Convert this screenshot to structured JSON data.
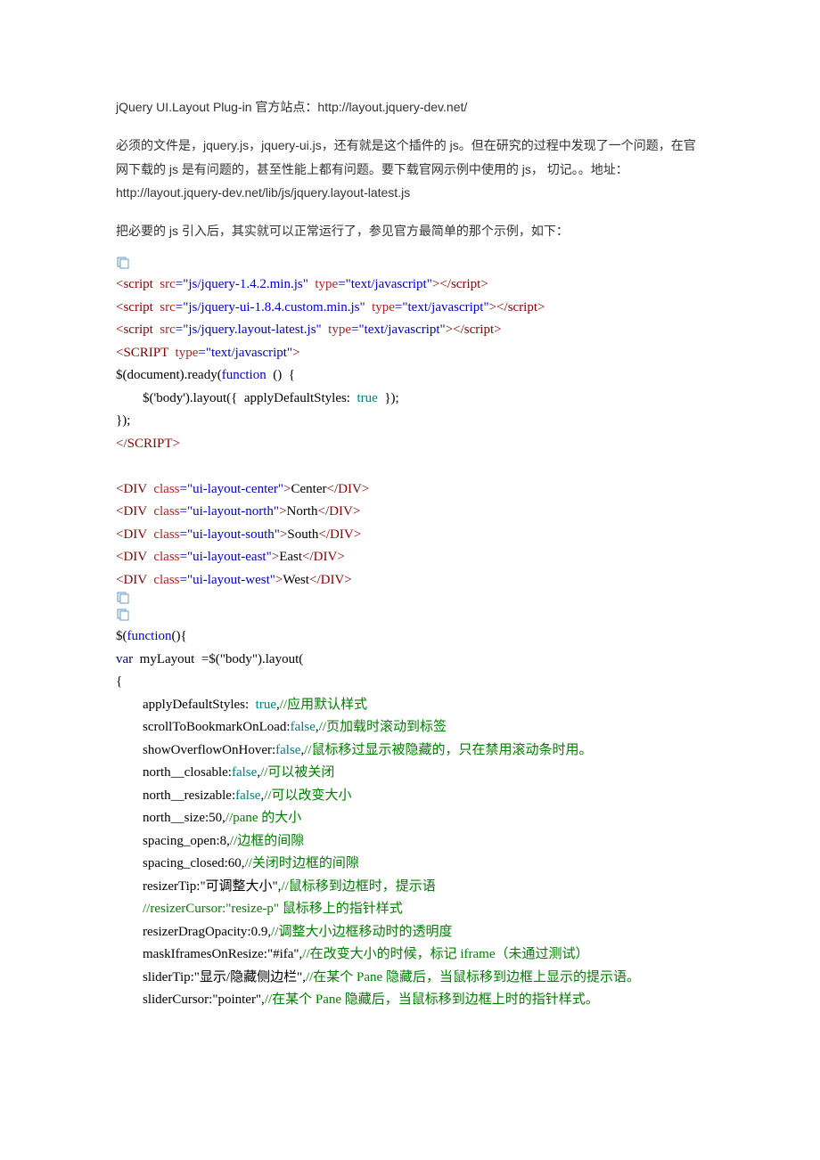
{
  "title": {
    "plugin": "jQuery UI.Layout Plug-in",
    "label": "  官方站点：",
    "url": "http://layout.jquery-dev.net/"
  },
  "para1": "必须的文件是，jquery.js，jquery-ui.js，还有就是这个插件的 js。但在研究的过程中发现了一个问题，在官网下载的 js 是有问题的，甚至性能上都有问题。要下载官网示例中使用的 js， 切记。。地址：http://layout.jquery-dev.net/lib/js/jquery.layout-latest.js",
  "para2": "把必要的 js 引入后，其实就可以正常运行了，参见官方最简单的那个示例，如下：",
  "code1": {
    "s1": {
      "tag_open": "<script",
      "src_attr": "  src",
      "src_val": "=\"js/jquery-1.4.2.min.js\"",
      "type_attr": "  type",
      "type_val": "=\"text/javascript\"",
      "close": "></",
      "end_tag": "script",
      "gt": ">"
    },
    "s2": {
      "tag_open": "<script",
      "src_attr": "  src",
      "src_val": "=\"js/jquery-ui-1.8.4.custom.min.js\"",
      "type_attr": "  type",
      "type_val": "=\"text/javascript\"",
      "close": "></",
      "end_tag": "script",
      "gt": ">"
    },
    "s3": {
      "tag_open": "<script",
      "src_attr": "  src",
      "src_val": "=\"js/jquery.layout-latest.js\"",
      "type_attr": "  type",
      "type_val": "=\"text/javascript\"",
      "close": "></",
      "end_tag": "script",
      "gt": ">"
    },
    "s4": {
      "tag_open": "<SCRIPT",
      "type_attr": "  type",
      "type_val": "=\"text/javascript\"",
      "gt": ">"
    },
    "l5a": "$(document).ready(",
    "l5b": "function",
    "l5c": "  ()  {",
    "l6a": "        $('body').layout({  applyDefaultStyles:  ",
    "l6b": "true",
    "l6c": "  });",
    "l7": "});",
    "s8": {
      "close": "</",
      "end_tag": "SCRIPT",
      "gt": ">"
    },
    "d1": {
      "open": "<DIV",
      "cls_attr": "  class",
      "cls_val": "=\"ui-layout-center\"",
      "gt": ">",
      "txt": "Center",
      "close": "</",
      "end_tag": "DIV",
      "gt2": ">"
    },
    "d2": {
      "open": "<DIV",
      "cls_attr": "  class",
      "cls_val": "=\"ui-layout-north\"",
      "gt": ">",
      "txt": "North",
      "close": "</",
      "end_tag": "DIV",
      "gt2": ">"
    },
    "d3": {
      "open": "<DIV",
      "cls_attr": "  class",
      "cls_val": "=\"ui-layout-south\"",
      "gt": ">",
      "txt": "South",
      "close": "</",
      "end_tag": "DIV",
      "gt2": ">"
    },
    "d4": {
      "open": "<DIV",
      "cls_attr": "  class",
      "cls_val": "=\"ui-layout-east\"",
      "gt": ">",
      "txt": "East",
      "close": "</",
      "end_tag": "DIV",
      "gt2": ">"
    },
    "d5": {
      "open": "<DIV",
      "cls_attr": "  class",
      "cls_val": "=\"ui-layout-west\"",
      "gt": ">",
      "txt": "West",
      "close": "</",
      "end_tag": "DIV",
      "gt2": ">"
    }
  },
  "code2": {
    "l1a": "$(",
    "l1b": "function",
    "l1c": "(){",
    "l2a": "var",
    "l2b": "  myLayout  =$(\"body\").layout(",
    "l3": "{",
    "l4a": "        applyDefaultStyles:  ",
    "l4b": "true",
    "l4c": ",",
    "l4d": "//应用默认样式",
    "l5a": "        scrollToBookmarkOnLoad:",
    "l5b": "false",
    "l5c": ",",
    "l5d": "//页加载时滚动到标签",
    "l6a": "        showOverflowOnHover:",
    "l6b": "false",
    "l6c": ",",
    "l6d": "//鼠标移过显示被隐藏的，只在禁用滚动条时用。",
    "l7a": "        north__closable:",
    "l7b": "false",
    "l7c": ",",
    "l7d": "//可以被关闭",
    "l8a": "        north__resizable:",
    "l8b": "false",
    "l8c": ",",
    "l8d": "//可以改变大小",
    "l9a": "        north__size:50,",
    "l9b": "//pane 的大小",
    "l10a": "        spacing_open:8,",
    "l10b": "//边框的间隙",
    "l11a": "        spacing_closed:60,",
    "l11b": "//关闭时边框的间隙",
    "l12a": "        resizerTip:\"可调整大小\",",
    "l12b": "//鼠标移到边框时，提示语",
    "l13": "        //resizerCursor:\"resize-p\" 鼠标移上的指针样式",
    "l14a": "        resizerDragOpacity:0.9,",
    "l14b": "//调整大小边框移动时的透明度",
    "l15a": "        maskIframesOnResize:\"#ifa\",",
    "l15b": "//在改变大小的时候，标记 iframe（未通过测试）",
    "l16a": "        sliderTip:\"显示/隐藏侧边栏\",",
    "l16b": "//在某个 Pane 隐藏后，当鼠标移到边框上显示的提示语。",
    "l17a": "        sliderCursor:\"pointer\",",
    "l17b": "//在某个 Pane 隐藏后，当鼠标移到边框上时的指针样式。"
  }
}
